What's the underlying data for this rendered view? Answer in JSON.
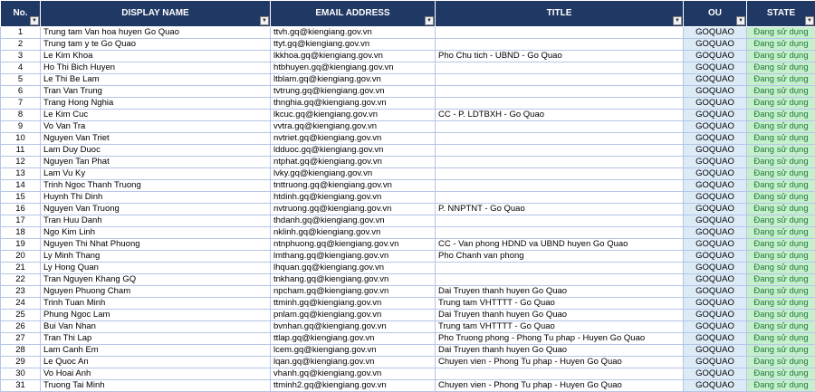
{
  "headers": {
    "no": "No.",
    "display_name": "DISPLAY NAME",
    "email": "EMAIL ADDRESS",
    "title": "TITLE",
    "ou": "OU",
    "state": "STATE"
  },
  "filter_icon": "filter-dropdown-arrow",
  "filter_glyph": "▼",
  "colors": {
    "header_bg": "#203864",
    "header_text": "#ffffff",
    "grid": "#b4c6e7",
    "ou_bg": "#ddebf7",
    "state_bg": "#c6efce",
    "state_text": "#1e7b34"
  },
  "rows": [
    {
      "no": "1",
      "name": "Trung tam Van hoa huyen Go Quao",
      "email": "ttvh.gq@kiengiang.gov.vn",
      "title": "",
      "ou": "GOQUAO",
      "state": "Đang sử dụng"
    },
    {
      "no": "2",
      "name": "Trung tam y te Go Quao",
      "email": "ttyt.gq@kiengiang.gov.vn",
      "title": "",
      "ou": "GOQUAO",
      "state": "Đang sử dụng"
    },
    {
      "no": "3",
      "name": "Le Kim Khoa",
      "email": "lkkhoa.gq@kiengiang.gov.vn",
      "title": "Pho Chu tich - UBND - Go Quao",
      "ou": "GOQUAO",
      "state": "Đang sử dụng"
    },
    {
      "no": "4",
      "name": "Ho Thi Bich Huyen",
      "email": "htbhuyen.gq@kiengiang.gov.vn",
      "title": "",
      "ou": "GOQUAO",
      "state": "Đang sử dụng"
    },
    {
      "no": "5",
      "name": "Le Thi Be Lam",
      "email": "ltblam.gq@kiengiang.gov.vn",
      "title": "",
      "ou": "GOQUAO",
      "state": "Đang sử dụng"
    },
    {
      "no": "6",
      "name": "Tran Van Trung",
      "email": "tvtrung.gq@kiengiang.gov.vn",
      "title": "",
      "ou": "GOQUAO",
      "state": "Đang sử dụng"
    },
    {
      "no": "7",
      "name": "Trang Hong Nghia",
      "email": "thnghia.gq@kiengiang.gov.vn",
      "title": "",
      "ou": "GOQUAO",
      "state": "Đang sử dụng"
    },
    {
      "no": "8",
      "name": "Le Kim Cuc",
      "email": "lkcuc.gq@kiengiang.gov.vn",
      "title": "CC - P. LDTBXH - Go Quao",
      "ou": "GOQUAO",
      "state": "Đang sử dụng"
    },
    {
      "no": "9",
      "name": "Vo Van Tra",
      "email": "vvtra.gq@kiengiang.gov.vn",
      "title": "",
      "ou": "GOQUAO",
      "state": "Đang sử dụng"
    },
    {
      "no": "10",
      "name": "Nguyen Van Triet",
      "email": "nvtriet.gq@kiengiang.gov.vn",
      "title": "",
      "ou": "GOQUAO",
      "state": "Đang sử dụng"
    },
    {
      "no": "11",
      "name": "Lam Duy Duoc",
      "email": "ldduoc.gq@kiengiang.gov.vn",
      "title": "",
      "ou": "GOQUAO",
      "state": "Đang sử dụng"
    },
    {
      "no": "12",
      "name": "Nguyen Tan Phat",
      "email": "ntphat.gq@kiengiang.gov.vn",
      "title": "",
      "ou": "GOQUAO",
      "state": "Đang sử dụng"
    },
    {
      "no": "13",
      "name": "Lam Vu Ky",
      "email": "lvky.gq@kiengiang.gov.vn",
      "title": "",
      "ou": "GOQUAO",
      "state": "Đang sử dụng"
    },
    {
      "no": "14",
      "name": "Trinh Ngoc Thanh Truong",
      "email": "tnttruong.gq@kiengiang.gov.vn",
      "title": "",
      "ou": "GOQUAO",
      "state": "Đang sử dụng"
    },
    {
      "no": "15",
      "name": "Huynh Thi Dinh",
      "email": "htdinh.gq@kiengiang.gov.vn",
      "title": "",
      "ou": "GOQUAO",
      "state": "Đang sử dụng"
    },
    {
      "no": "16",
      "name": "Nguyen Van Truong",
      "email": "nvtruong.gq@kiengiang.gov.vn",
      "title": "P. NNPTNT - Go Quao",
      "ou": "GOQUAO",
      "state": "Đang sử dụng"
    },
    {
      "no": "17",
      "name": "Tran Huu Danh",
      "email": "thdanh.gq@kiengiang.gov.vn",
      "title": "",
      "ou": "GOQUAO",
      "state": "Đang sử dụng"
    },
    {
      "no": "18",
      "name": "Ngo Kim Linh",
      "email": "nklinh.gq@kiengiang.gov.vn",
      "title": "",
      "ou": "GOQUAO",
      "state": "Đang sử dụng"
    },
    {
      "no": "19",
      "name": "Nguyen Thi Nhat Phuong",
      "email": "ntnphuong.gq@kiengiang.gov.vn",
      "title": "CC - Van phong HDND va UBND huyen Go Quao",
      "ou": "GOQUAO",
      "state": "Đang sử dụng"
    },
    {
      "no": "20",
      "name": "Ly Minh Thang",
      "email": "lmthang.gq@kiengiang.gov.vn",
      "title": "Pho Chanh van phong",
      "ou": "GOQUAO",
      "state": "Đang sử dụng"
    },
    {
      "no": "21",
      "name": "Ly Hong Quan",
      "email": "lhquan.gq@kiengiang.gov.vn",
      "title": "",
      "ou": "GOQUAO",
      "state": "Đang sử dụng"
    },
    {
      "no": "22",
      "name": "Tran Nguyen Khang GQ",
      "email": "tnkhang.gq@kiengiang.gov.vn",
      "title": "",
      "ou": "GOQUAO",
      "state": "Đang sử dụng"
    },
    {
      "no": "23",
      "name": "Nguyen Phuong Cham",
      "email": "npcham.gq@kiengiang.gov.vn",
      "title": "Dai Truyen thanh huyen Go Quao",
      "ou": "GOQUAO",
      "state": "Đang sử dụng"
    },
    {
      "no": "24",
      "name": "Trinh Tuan Minh",
      "email": "ttminh.gq@kiengiang.gov.vn",
      "title": "Trung tam VHTTTT - Go Quao",
      "ou": "GOQUAO",
      "state": "Đang sử dụng"
    },
    {
      "no": "25",
      "name": "Phung Ngoc Lam",
      "email": "pnlam.gq@kiengiang.gov.vn",
      "title": "Dai Truyen thanh huyen Go Quao",
      "ou": "GOQUAO",
      "state": "Đang sử dụng"
    },
    {
      "no": "26",
      "name": "Bui Van Nhan",
      "email": "bvnhan.gq@kiengiang.gov.vn",
      "title": "Trung tam VHTTTT - Go Quao",
      "ou": "GOQUAO",
      "state": "Đang sử dụng"
    },
    {
      "no": "27",
      "name": "Tran Thi Lap",
      "email": "ttlap.gq@kiengiang.gov.vn",
      "title": "Pho Truong phong - Phong Tu phap - Huyen Go Quao",
      "ou": "GOQUAO",
      "state": "Đang sử dụng"
    },
    {
      "no": "28",
      "name": "Lam Canh Em",
      "email": "lcem.gq@kiengiang.gov.vn",
      "title": "Dai Truyen thanh huyen Go Quao",
      "ou": "GOQUAO",
      "state": "Đang sử dụng"
    },
    {
      "no": "29",
      "name": "Le Quoc An",
      "email": "lqan.gq@kiengiang.gov.vn",
      "title": "Chuyen vien - Phong Tu phap - Huyen Go Quao",
      "ou": "GOQUAO",
      "state": "Đang sử dụng"
    },
    {
      "no": "30",
      "name": "Vo Hoai Anh",
      "email": "vhanh.gq@kiengiang.gov.vn",
      "title": "",
      "ou": "GOQUAO",
      "state": "Đang sử dụng"
    },
    {
      "no": "31",
      "name": "Truong Tai Minh",
      "email": "ttminh2.gq@kiengiang.gov.vn",
      "title": "Chuyen vien - Phong Tu phap - Huyen Go Quao",
      "ou": "GOQUAO",
      "state": "Đang sử dụng"
    }
  ]
}
